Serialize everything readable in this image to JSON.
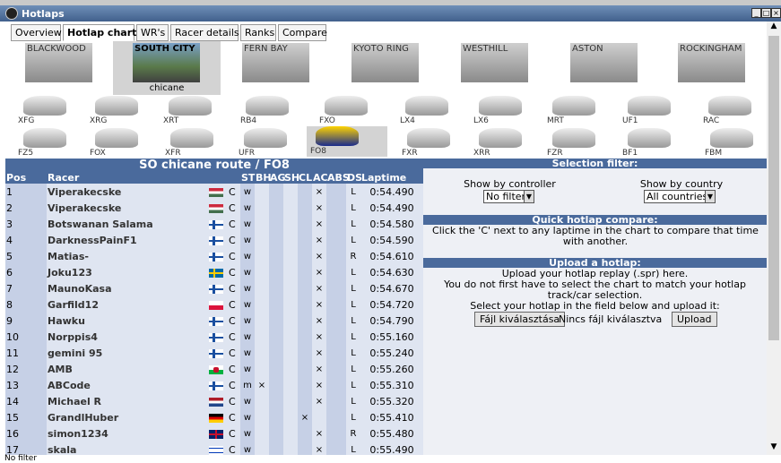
{
  "window": {
    "title": "Hotlaps"
  },
  "tabs": [
    "Overview",
    "Hotlap charts",
    "WR's",
    "Racer details",
    "Ranks",
    "Compare"
  ],
  "active_tab": "Hotlap charts",
  "tracks": [
    "BLACKWOOD",
    "SOUTH CITY",
    "FERN BAY",
    "KYOTO RING",
    "WESTHILL",
    "ASTON",
    "ROCKINGHAM"
  ],
  "active_track": "SOUTH CITY",
  "active_track_config": "chicane",
  "cars_row1": [
    "XFG",
    "XRG",
    "XRT",
    "RB4",
    "FXO",
    "LX4",
    "LX6",
    "MRT",
    "UF1",
    "RAC"
  ],
  "cars_row2": [
    "FZ5",
    "FOX",
    "XFR",
    "UFR",
    "FO8",
    "FXR",
    "XRR",
    "FZR",
    "BF1",
    "FBM"
  ],
  "active_car": "FO8",
  "chart": {
    "heading": "SO chicane route / FO8",
    "columns": [
      "Pos",
      "Racer",
      "",
      "",
      "ST",
      "BH",
      "AG",
      "SH",
      "CL",
      "AC",
      "ABS",
      "DS",
      "Laptime"
    ],
    "rows": [
      {
        "pos": "1",
        "name": "Viperakecske",
        "flag": "hu",
        "c": "C",
        "st": "w",
        "bh": "",
        "ag": "",
        "sh": "",
        "cl": "",
        "ac": "×",
        "abs": "",
        "ds": "L",
        "time": "0:54.490"
      },
      {
        "pos": "2",
        "name": "Viperakecske",
        "flag": "hu",
        "c": "C",
        "st": "w",
        "bh": "",
        "ag": "",
        "sh": "",
        "cl": "",
        "ac": "×",
        "abs": "",
        "ds": "L",
        "time": "0:54.490"
      },
      {
        "pos": "3",
        "name": "Botswanan Salama",
        "flag": "fi",
        "c": "C",
        "st": "w",
        "bh": "",
        "ag": "",
        "sh": "",
        "cl": "",
        "ac": "×",
        "abs": "",
        "ds": "L",
        "time": "0:54.580"
      },
      {
        "pos": "4",
        "name": "DarknessPainF1",
        "flag": "fi",
        "c": "C",
        "st": "w",
        "bh": "",
        "ag": "",
        "sh": "",
        "cl": "",
        "ac": "×",
        "abs": "",
        "ds": "L",
        "time": "0:54.590"
      },
      {
        "pos": "5",
        "name": "Matias-",
        "flag": "fi",
        "c": "C",
        "st": "w",
        "bh": "",
        "ag": "",
        "sh": "",
        "cl": "",
        "ac": "×",
        "abs": "",
        "ds": "R",
        "time": "0:54.610"
      },
      {
        "pos": "6",
        "name": "Joku123",
        "flag": "se",
        "c": "C",
        "st": "w",
        "bh": "",
        "ag": "",
        "sh": "",
        "cl": "",
        "ac": "×",
        "abs": "",
        "ds": "L",
        "time": "0:54.630"
      },
      {
        "pos": "7",
        "name": "MaunoKasa",
        "flag": "fi",
        "c": "C",
        "st": "w",
        "bh": "",
        "ag": "",
        "sh": "",
        "cl": "",
        "ac": "×",
        "abs": "",
        "ds": "L",
        "time": "0:54.670"
      },
      {
        "pos": "8",
        "name": "Garfild12",
        "flag": "pl",
        "c": "C",
        "st": "w",
        "bh": "",
        "ag": "",
        "sh": "",
        "cl": "",
        "ac": "×",
        "abs": "",
        "ds": "L",
        "time": "0:54.720"
      },
      {
        "pos": "9",
        "name": "Hawku",
        "flag": "fi",
        "c": "C",
        "st": "w",
        "bh": "",
        "ag": "",
        "sh": "",
        "cl": "",
        "ac": "×",
        "abs": "",
        "ds": "L",
        "time": "0:54.790"
      },
      {
        "pos": "10",
        "name": "Norppis4",
        "flag": "fi",
        "c": "C",
        "st": "w",
        "bh": "",
        "ag": "",
        "sh": "",
        "cl": "",
        "ac": "×",
        "abs": "",
        "ds": "L",
        "time": "0:55.160"
      },
      {
        "pos": "11",
        "name": "gemini 95",
        "flag": "fi",
        "c": "C",
        "st": "w",
        "bh": "",
        "ag": "",
        "sh": "",
        "cl": "",
        "ac": "×",
        "abs": "",
        "ds": "L",
        "time": "0:55.240"
      },
      {
        "pos": "12",
        "name": "AMB",
        "flag": "wales",
        "c": "C",
        "st": "w",
        "bh": "",
        "ag": "",
        "sh": "",
        "cl": "",
        "ac": "×",
        "abs": "",
        "ds": "L",
        "time": "0:55.260"
      },
      {
        "pos": "13",
        "name": "ABCode",
        "flag": "fi",
        "c": "C",
        "st": "m",
        "bh": "×",
        "ag": "",
        "sh": "",
        "cl": "",
        "ac": "×",
        "abs": "",
        "ds": "L",
        "time": "0:55.310"
      },
      {
        "pos": "14",
        "name": "Michael R",
        "flag": "nl",
        "c": "C",
        "st": "w",
        "bh": "",
        "ag": "",
        "sh": "",
        "cl": "",
        "ac": "×",
        "abs": "",
        "ds": "L",
        "time": "0:55.320"
      },
      {
        "pos": "15",
        "name": "GrandlHuber",
        "flag": "de",
        "c": "C",
        "st": "w",
        "bh": "",
        "ag": "",
        "sh": "",
        "cl": "×",
        "ac": "",
        "abs": "",
        "ds": "L",
        "time": "0:55.410"
      },
      {
        "pos": "16",
        "name": "simon1234",
        "flag": "gb",
        "c": "C",
        "st": "w",
        "bh": "",
        "ag": "",
        "sh": "",
        "cl": "",
        "ac": "×",
        "abs": "",
        "ds": "R",
        "time": "0:55.480"
      },
      {
        "pos": "17",
        "name": "skala",
        "flag": "il",
        "c": "C",
        "st": "w",
        "bh": "",
        "ag": "",
        "sh": "",
        "cl": "",
        "ac": "×",
        "abs": "",
        "ds": "L",
        "time": "0:55.490"
      }
    ]
  },
  "selection_filter": {
    "heading": "Selection filter:",
    "controller_label": "Show by controller",
    "controller_value": "No filter",
    "country_label": "Show by country",
    "country_value": "All countries"
  },
  "quick_compare": {
    "heading": "Quick hotlap compare:",
    "text": "Click the 'C' next to any laptime in the chart to compare that time with another."
  },
  "upload": {
    "heading": "Upload a hotlap:",
    "line1": "Upload your hotlap replay (.spr) here.",
    "line2": "You do not first have to select the chart to match your hotlap track/car selection.",
    "line3": "Select your hotlap in the field below and upload it:",
    "file_button": "Fájl kiválasztása",
    "file_status": "Nincs fájl kiválasztva",
    "upload_button": "Upload"
  },
  "status_text": "No filter",
  "colors": {
    "header_blue": "#4a6a9c",
    "row_light": "#dfe5f1",
    "row_dark": "#c6d0e6"
  }
}
